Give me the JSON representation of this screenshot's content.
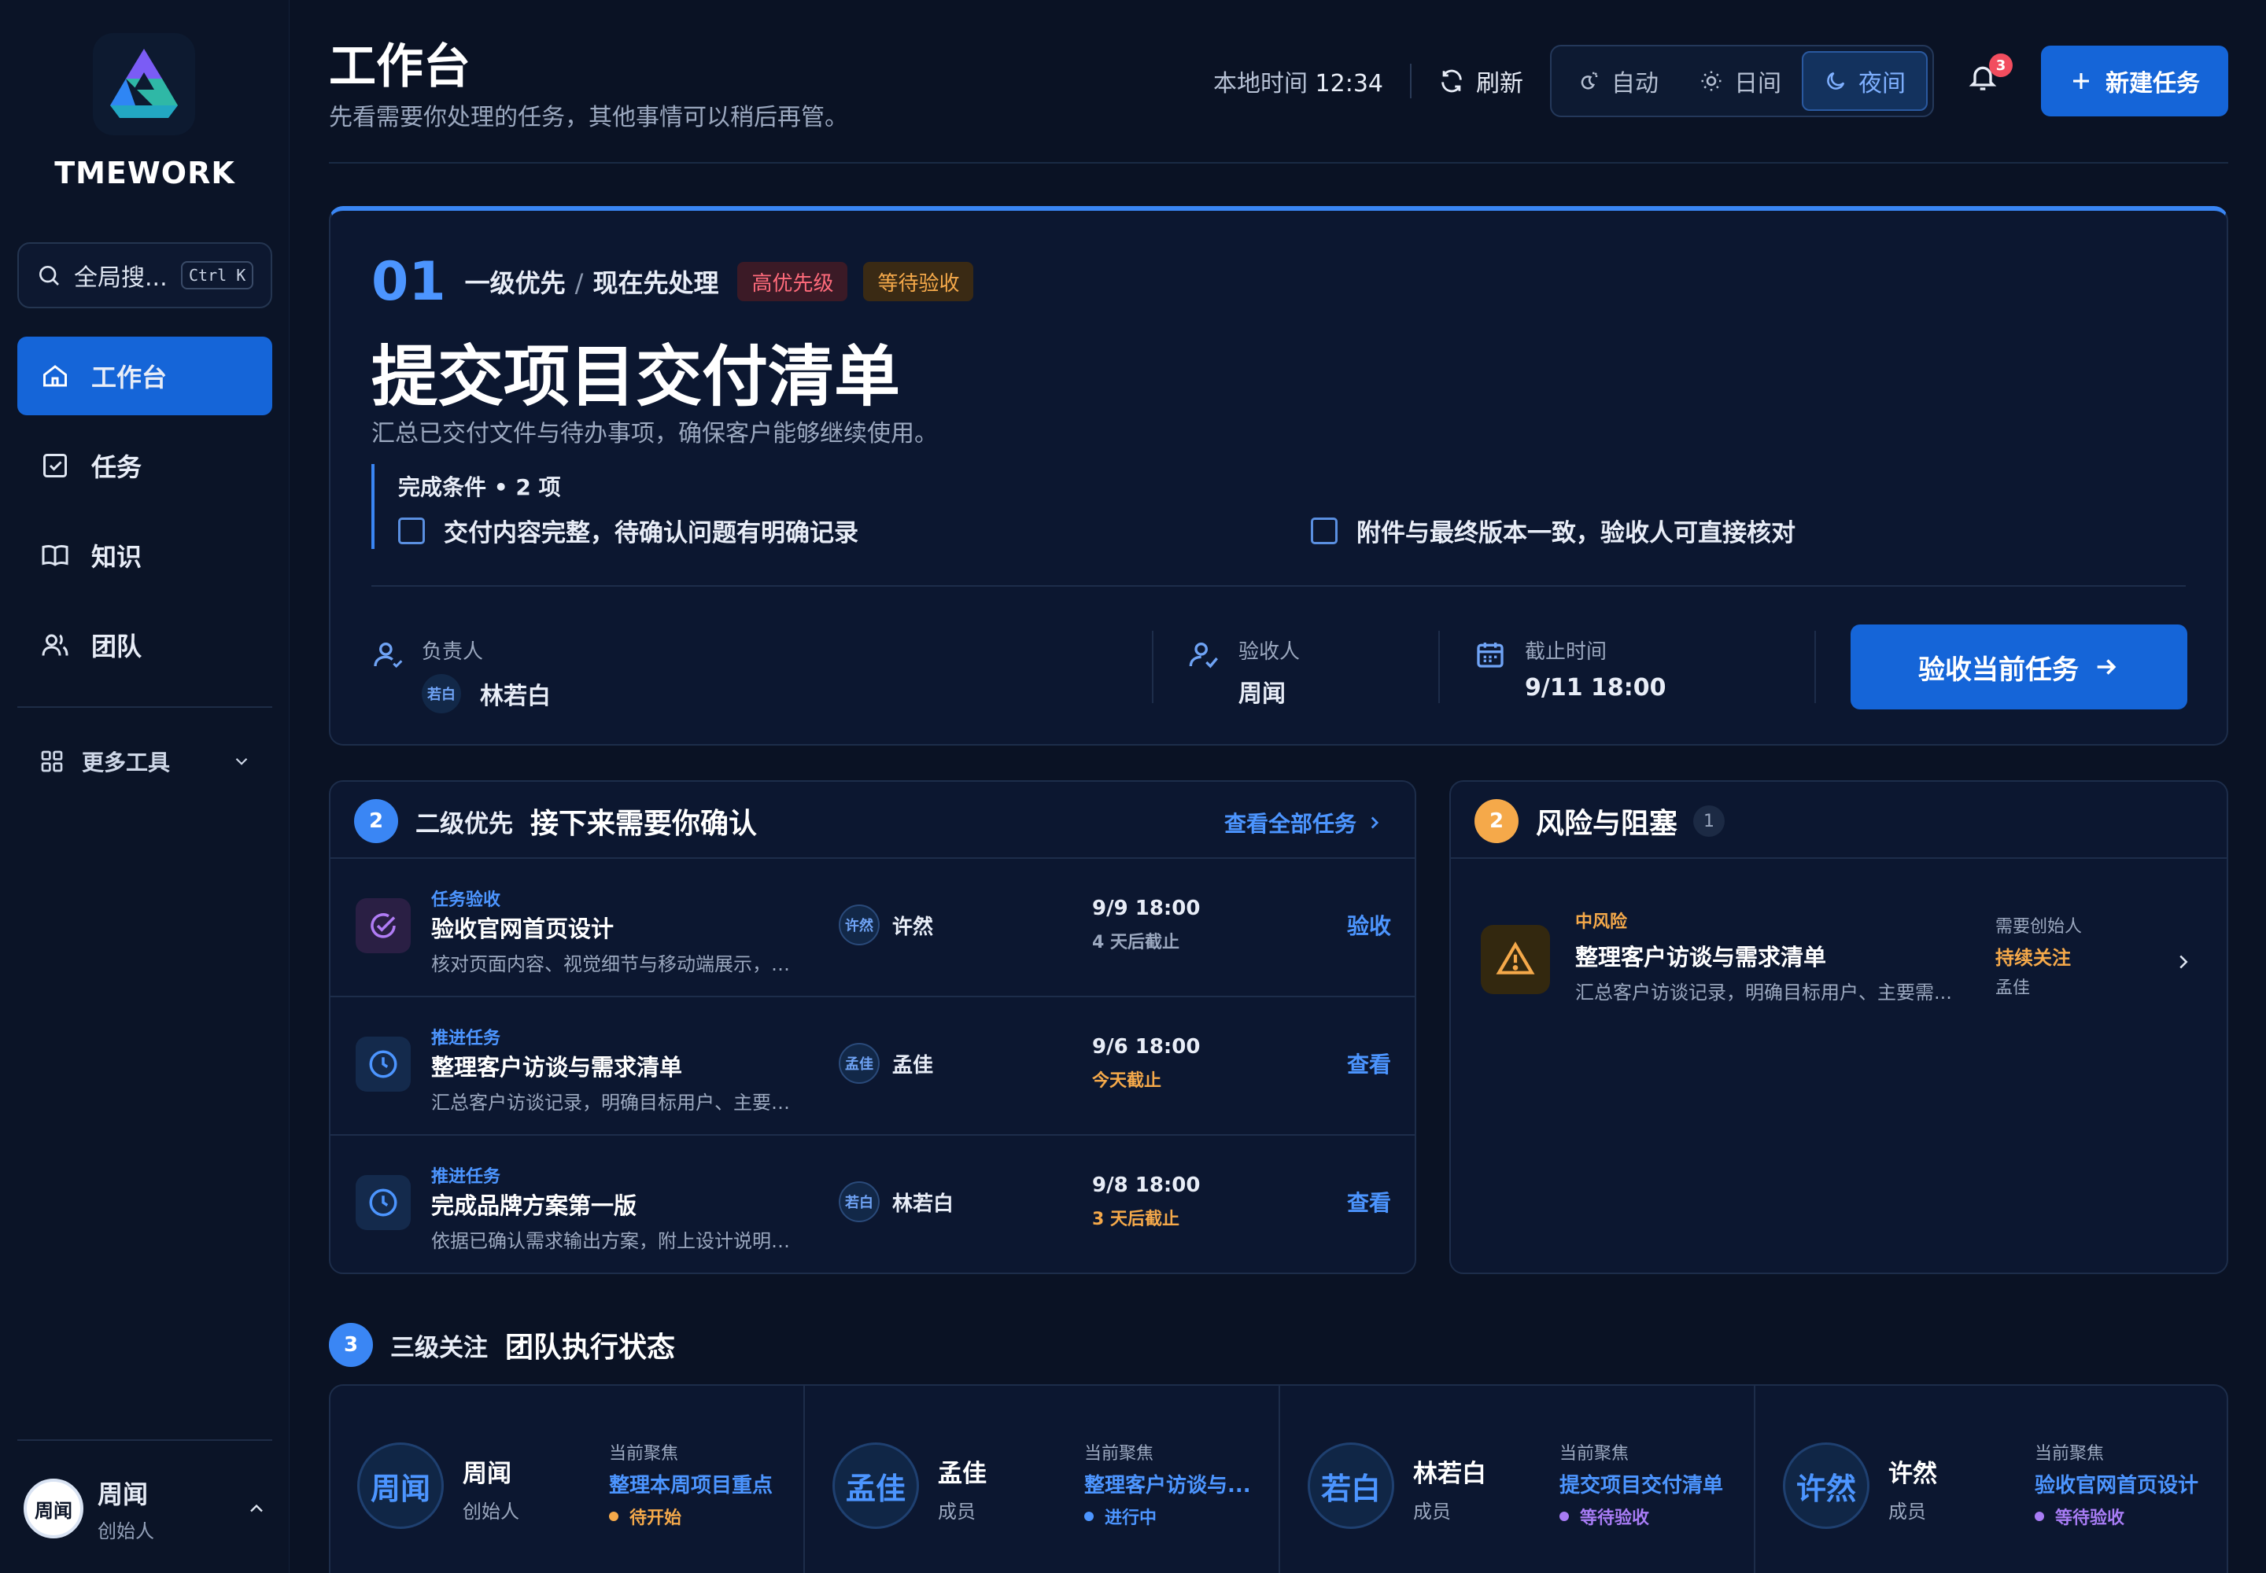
{
  "brand": {
    "name": "TMEWORK"
  },
  "sidebar": {
    "search": {
      "placeholder": "全局搜...",
      "shortcut": "Ctrl K"
    },
    "items": [
      {
        "label": "工作台",
        "icon": "home-icon",
        "active": true
      },
      {
        "label": "任务",
        "icon": "checkbox-icon"
      },
      {
        "label": "知识",
        "icon": "book-icon"
      },
      {
        "label": "团队",
        "icon": "users-icon"
      }
    ],
    "more_tools": "更多工具",
    "user": {
      "avatar": "周闻",
      "name": "周闻",
      "role": "创始人"
    }
  },
  "header": {
    "title": "工作台",
    "subtitle": "先看需要你处理的任务，其他事情可以稍后再管。",
    "local_time_label": "本地时间",
    "local_time": "12:34",
    "refresh": "刷新",
    "theme": {
      "auto": "自动",
      "day": "日间",
      "night": "夜间",
      "selected": "night"
    },
    "notifications": "3",
    "new_task": "新建任务"
  },
  "hero": {
    "number": "01",
    "priority": "一级优先",
    "separator": "/",
    "context": "现在先处理",
    "tags": [
      "高优先级",
      "等待验收"
    ],
    "title": "提交项目交付清单",
    "description": "汇总已交付文件与待办事项，确保客户能够继续使用。",
    "conditions_title": "完成条件 • 2 项",
    "conditions": [
      "交付内容完整，待确认问题有明确记录",
      "附件与最终版本一致，验收人可直接核对"
    ],
    "owner_label": "负责人",
    "owner_avatar": "若白",
    "owner": "林若白",
    "reviewer_label": "验收人",
    "reviewer": "周闻",
    "deadline_label": "截止时间",
    "deadline": "9/11 18:00",
    "action": "验收当前任务"
  },
  "confirm": {
    "badge": "2",
    "priority": "二级优先",
    "title": "接下来需要你确认",
    "see_all": "查看全部任务",
    "tasks": [
      {
        "type": "任务验收",
        "title": "验收官网首页设计",
        "desc": "核对页面内容、视觉细节与移动端展示，提交...",
        "owner_avatar": "许然",
        "owner": "许然",
        "time": "9/9 18:00",
        "due": "4 天后截止",
        "action": "验收"
      },
      {
        "type": "推进任务",
        "title": "整理客户访谈与需求清单",
        "desc": "汇总客户访谈记录，明确目标用户、主要需求...",
        "owner_avatar": "孟佳",
        "owner": "孟佳",
        "time": "9/6 18:00",
        "due": "今天截止",
        "action": "查看"
      },
      {
        "type": "推进任务",
        "title": "完成品牌方案第一版",
        "desc": "依据已确认需求输出方案，附上设计说明供团...",
        "owner_avatar": "若白",
        "owner": "林若白",
        "time": "9/8 18:00",
        "due": "3 天后截止",
        "action": "查看"
      }
    ]
  },
  "risk": {
    "badge": "2",
    "title": "风险与阻塞",
    "count": "1",
    "item": {
      "level": "中风险",
      "title": "整理客户访谈与需求清单",
      "desc": "汇总客户访谈记录，明确目标用户、主要需...",
      "who_label": "需要创始人",
      "status": "持续关注",
      "person": "孟佳"
    }
  },
  "team": {
    "badge": "3",
    "priority": "三级关注",
    "title": "团队执行状态",
    "focus_label": "当前聚焦",
    "members": [
      {
        "avatar": "周闻",
        "name": "周闻",
        "role": "创始人",
        "focus": "整理本周项目重点",
        "state": "待开始",
        "state_color": "#f5a94a"
      },
      {
        "avatar": "孟佳",
        "name": "孟佳",
        "role": "成员",
        "focus": "整理客户访谈与...",
        "state": "进行中",
        "state_color": "#4c95ff"
      },
      {
        "avatar": "若白",
        "name": "林若白",
        "role": "成员",
        "focus": "提交项目交付清单",
        "state": "等待验收",
        "state_color": "#a87cf5"
      },
      {
        "avatar": "许然",
        "name": "许然",
        "role": "成员",
        "focus": "验收官网首页设计",
        "state": "等待验收",
        "state_color": "#a87cf5"
      }
    ]
  }
}
